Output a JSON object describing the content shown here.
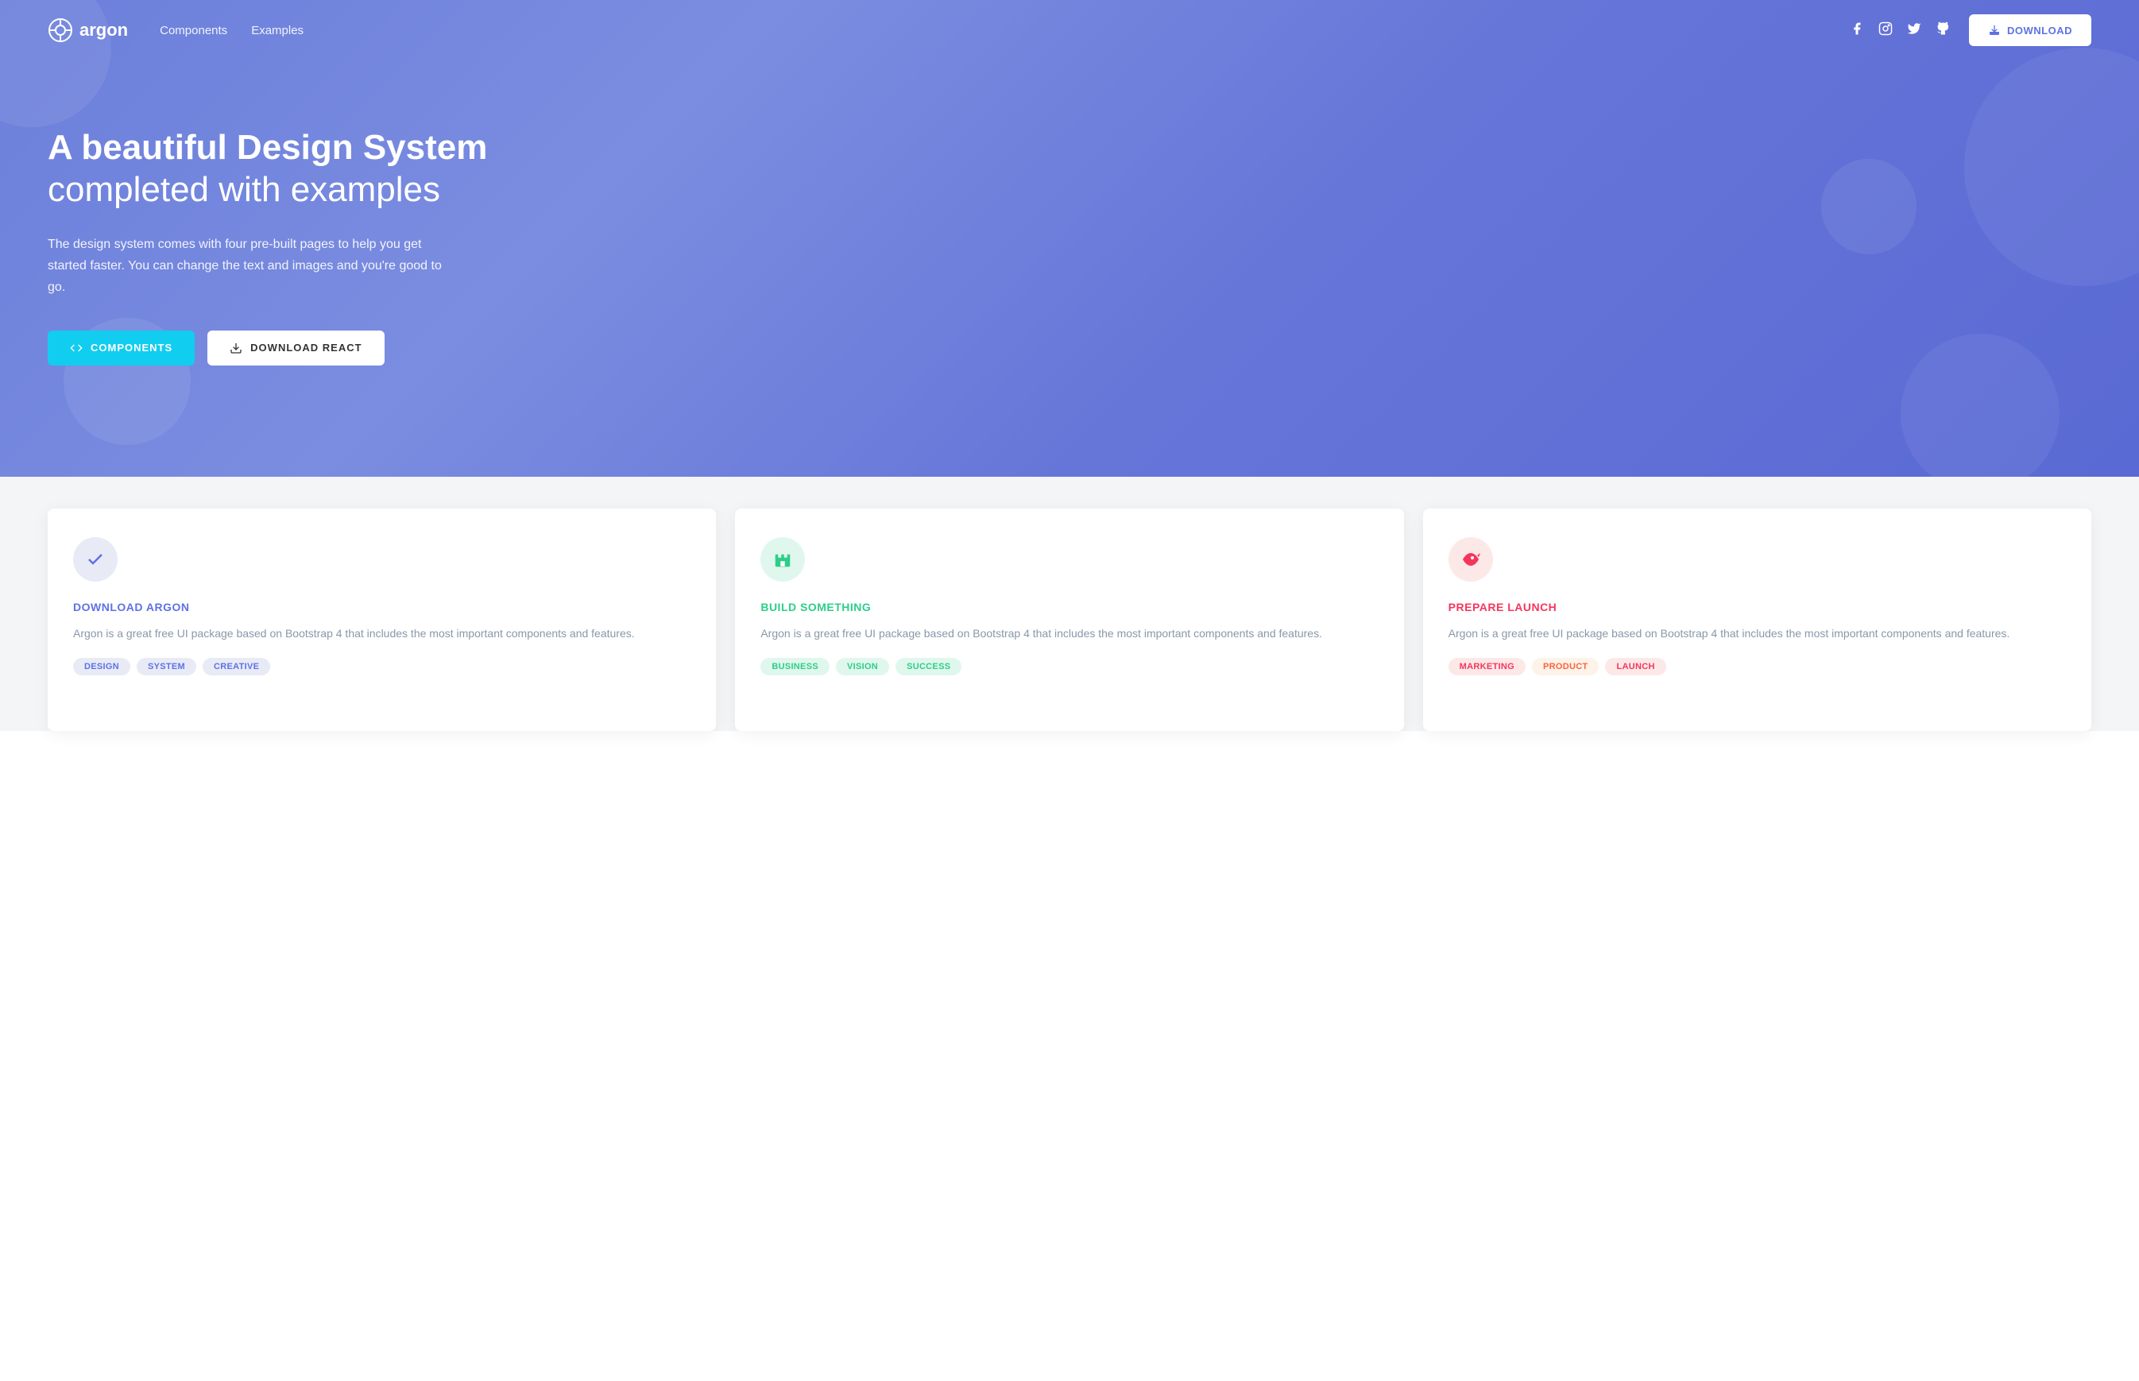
{
  "navbar": {
    "brand_name": "argon",
    "nav_links": [
      {
        "label": "Components",
        "id": "components"
      },
      {
        "label": "Examples",
        "id": "examples"
      }
    ],
    "social_icons": [
      "facebook",
      "instagram",
      "twitter",
      "github"
    ],
    "download_label": "DOWNLOAD"
  },
  "hero": {
    "title_bold": "A beautiful Design System",
    "title_light": "completed with examples",
    "description": "The design system comes with four pre-built pages to help you get started faster. You can change the text and images and you're good to go.",
    "btn_components": "COMPONENTS",
    "btn_react": "DOWNLOAD REACT"
  },
  "cards": [
    {
      "id": "download-argon",
      "icon_symbol": "✓",
      "icon_style": "blue",
      "title": "DOWNLOAD ARGON",
      "text": "Argon is a great free UI package based on Bootstrap 4 that includes the most important components and features.",
      "tags": [
        {
          "label": "DESIGN",
          "style": "blue"
        },
        {
          "label": "SYSTEM",
          "style": "blue"
        },
        {
          "label": "CREATIVE",
          "style": "blue"
        }
      ]
    },
    {
      "id": "build-something",
      "icon_symbol": "🏰",
      "icon_style": "green",
      "title": "BUILD SOMETHING",
      "text": "Argon is a great free UI package based on Bootstrap 4 that includes the most important components and features.",
      "tags": [
        {
          "label": "BUSINESS",
          "style": "green"
        },
        {
          "label": "VISION",
          "style": "green"
        },
        {
          "label": "SUCCESS",
          "style": "green"
        }
      ]
    },
    {
      "id": "prepare-launch",
      "icon_symbol": "🐠",
      "icon_style": "red",
      "title": "PREPARE LAUNCH",
      "text": "Argon is a great free UI package based on Bootstrap 4 that includes the most important components and features.",
      "tags": [
        {
          "label": "MARKETING",
          "style": "red"
        },
        {
          "label": "PRODUCT",
          "style": "red"
        },
        {
          "label": "LAUNCH",
          "style": "red"
        }
      ]
    }
  ]
}
